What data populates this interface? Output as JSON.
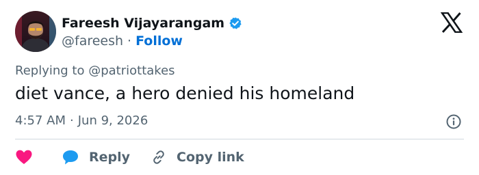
{
  "author": {
    "display_name": "Fareesh Vijayarangam",
    "handle": "@fareesh",
    "separator": "·",
    "follow_label": "Follow",
    "verified": true
  },
  "tweet": {
    "replying_to_prefix": "Replying to",
    "replying_to_handle": "@patriottakes",
    "text": "diet vance, a hero denied his homeland",
    "time": "4:57 AM",
    "separator": "·",
    "date": "Jun 9, 2026"
  },
  "actions": {
    "like_icon": "heart-icon",
    "reply_label": "Reply",
    "copy_link_label": "Copy link"
  },
  "icons": {
    "platform": "x-logo-icon",
    "verified": "verified-badge-icon",
    "info": "info-icon"
  },
  "colors": {
    "accent": "#1d9bf0",
    "follow": "#006fd6",
    "like": "#f91880",
    "muted": "#536471",
    "text": "#0f1419"
  }
}
